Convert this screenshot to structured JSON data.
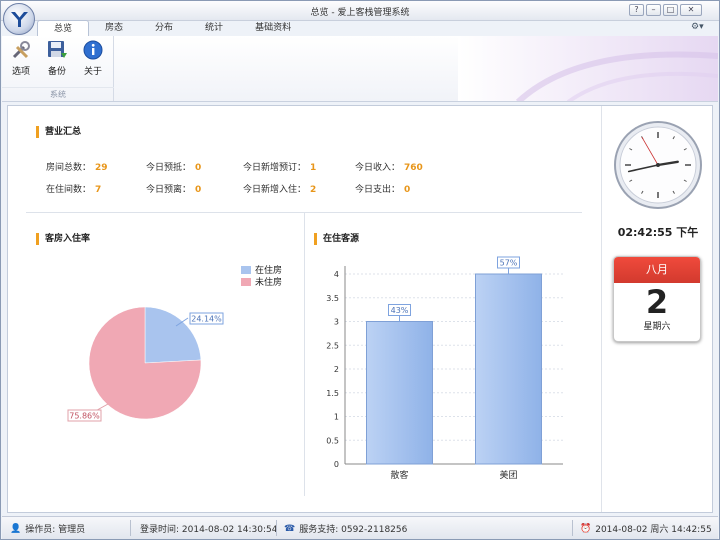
{
  "window": {
    "title": "总览 - 爱上客栈管理系统"
  },
  "tabs": [
    "总览",
    "房态",
    "分布",
    "统计",
    "基础资料"
  ],
  "ribbon": {
    "buttons": [
      "选项",
      "备份",
      "关于"
    ],
    "group_label": "系统"
  },
  "summary": {
    "title": "营业汇总",
    "row1": [
      {
        "label": "房间总数：",
        "value": "29"
      },
      {
        "label": "今日预抵：",
        "value": "0"
      },
      {
        "label": "今日新增预订：",
        "value": "1"
      },
      {
        "label": "今日收入：",
        "value": "760"
      }
    ],
    "row2": [
      {
        "label": "在住间数：",
        "value": "7"
      },
      {
        "label": "今日预离：",
        "value": "0"
      },
      {
        "label": "今日新增入住：",
        "value": "2"
      },
      {
        "label": "今日支出：",
        "value": "0"
      }
    ]
  },
  "occupancy": {
    "title": "客房入住率",
    "legend": [
      "在住房",
      "未住房"
    ],
    "labels": [
      "24.14%",
      "75.86%"
    ]
  },
  "source": {
    "title": "在住客源",
    "y_ticks": [
      "0",
      "0.5",
      "1",
      "1.5",
      "2",
      "2.5",
      "3",
      "3.5",
      "4"
    ],
    "categories": [
      "散客",
      "美团"
    ],
    "labels": [
      "43%",
      "57%"
    ]
  },
  "chart_data": [
    {
      "type": "pie",
      "title": "客房入住率",
      "categories": [
        "在住房",
        "未住房"
      ],
      "values": [
        24.14,
        75.86
      ],
      "colors": [
        "#a9c4ee",
        "#f0a8b4"
      ]
    },
    {
      "type": "bar",
      "title": "在住客源",
      "categories": [
        "散客",
        "美团"
      ],
      "values": [
        3,
        4
      ],
      "ylim": [
        0,
        4
      ],
      "data_labels": [
        "43%",
        "57%"
      ],
      "color": "#a8c4ef"
    }
  ],
  "clock": {
    "time": "02:42:55 下午",
    "hour": 14,
    "minute": 42,
    "second": 55
  },
  "calendar": {
    "month": "八月",
    "day": "2",
    "weekday": "星期六"
  },
  "status": {
    "operator": "操作员: 管理员",
    "login": "登录时间: 2014-08-02 14:30:54",
    "support": "服务支持: 0592-2118256",
    "datetime": "2014-08-02 周六 14:42:55"
  },
  "colors": {
    "accent": "#f0a020",
    "value": "#e8961a",
    "pie_in": "#a9c4ee",
    "pie_out": "#f0a8b4",
    "bar": "#a8c4ef"
  }
}
